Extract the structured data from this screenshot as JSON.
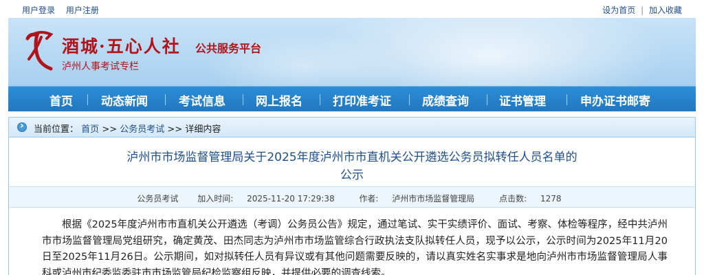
{
  "topbar": {
    "login": "用户登录",
    "register": "用户注册",
    "set_home": "设为首页",
    "separator": "|",
    "favorite": "加入收藏"
  },
  "banner": {
    "brand": "酒城·五心人社",
    "brand_sub": "公共服务平台",
    "tagline": "泸州人事考试专栏",
    "logo_icon": "logo-mark-icon",
    "brand_color": "#b1131b"
  },
  "nav": {
    "items": [
      "首页",
      "动态新闻",
      "考试信息",
      "网上报名",
      "打印准考证",
      "成绩查询",
      "证书管理",
      "申办证书邮寄"
    ]
  },
  "breadcrumb": {
    "prefix": "当前位置：",
    "home": "首页",
    "sep1": ">>",
    "category": "公务员考试",
    "sep2": ">>",
    "current": "详细内容"
  },
  "article": {
    "title_line1": "泸州市市场监督管理局关于2025年度泸州市市直机关公开遴选公务员拟转任人员名单的",
    "title_line2": "公示",
    "meta": {
      "category": "公务员考试",
      "time_label": "加入时间:",
      "time": "2025-11-20 17:29:38",
      "author_label": "作者:",
      "author": "泸州市市场监督管理局",
      "hits_label": "点击数:",
      "hits": "1278"
    },
    "body": "根据《2025年度泸州市市直机关公开遴选（考调）公务员公告》规定，通过笔试、实干实绩评价、面试、考察、体检等程序，经中共泸州市市场监督管理局党组研究，确定黄茂、田杰同志为泸州市市场监管综合行政执法支队拟转任人员，现予以公示，公示时间为2025年11月20日至2025年11月26日。公示期间，如对拟转任人员有异议或有其他问题需要反映的，请以真实姓名实事求是地向泸州市市场监督管理局人事科或泸州市纪委监委驻市市场监管局纪检监察组反映，并提供必要的调查线索。"
  }
}
